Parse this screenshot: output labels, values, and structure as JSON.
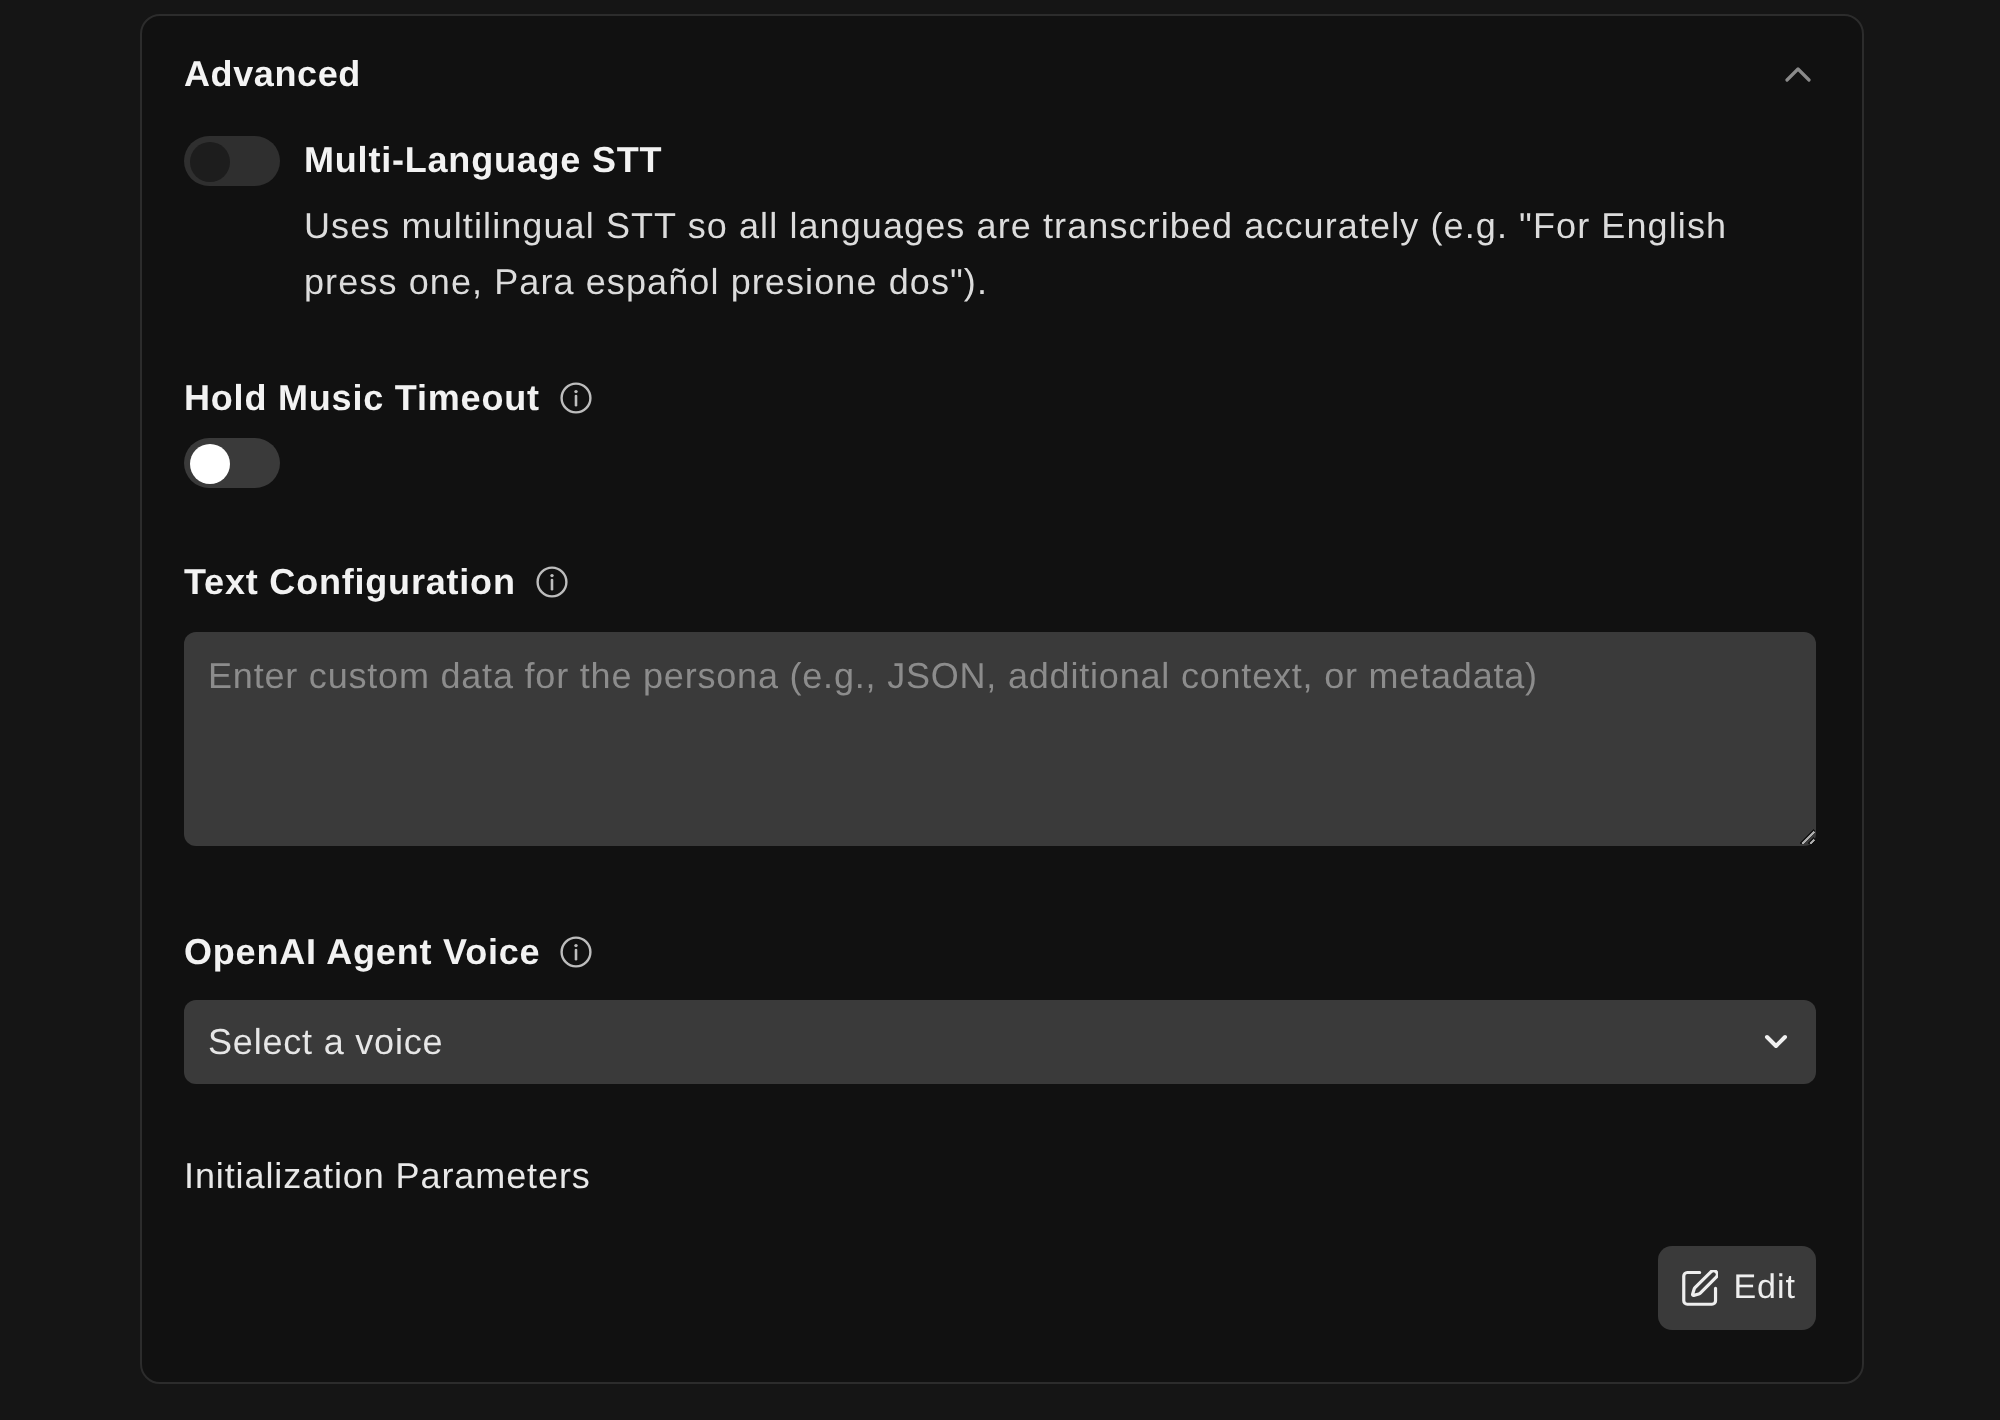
{
  "section": {
    "title": "Advanced",
    "expanded": true
  },
  "fields": [
    {
      "kind": "toggle",
      "label": "Multi-Language STT",
      "on": false,
      "disabled": true,
      "description": "Uses multilingual STT so all languages are transcribed accurately (e.g. \"For English press one, Para español presione dos\")."
    },
    {
      "kind": "toggle_field",
      "label": "Hold Music Timeout",
      "info": true,
      "on": false,
      "disabled": false
    },
    {
      "kind": "textarea",
      "label": "Text Configuration",
      "info": true,
      "placeholder": "Enter custom data for the persona (e.g., JSON, additional context, or metadata)"
    },
    {
      "kind": "select",
      "label": "OpenAI Agent Voice",
      "info": true,
      "placeholder": "Select a voice"
    },
    {
      "kind": "edit",
      "label": "Initialization Parameters",
      "button": "Edit"
    }
  ]
}
